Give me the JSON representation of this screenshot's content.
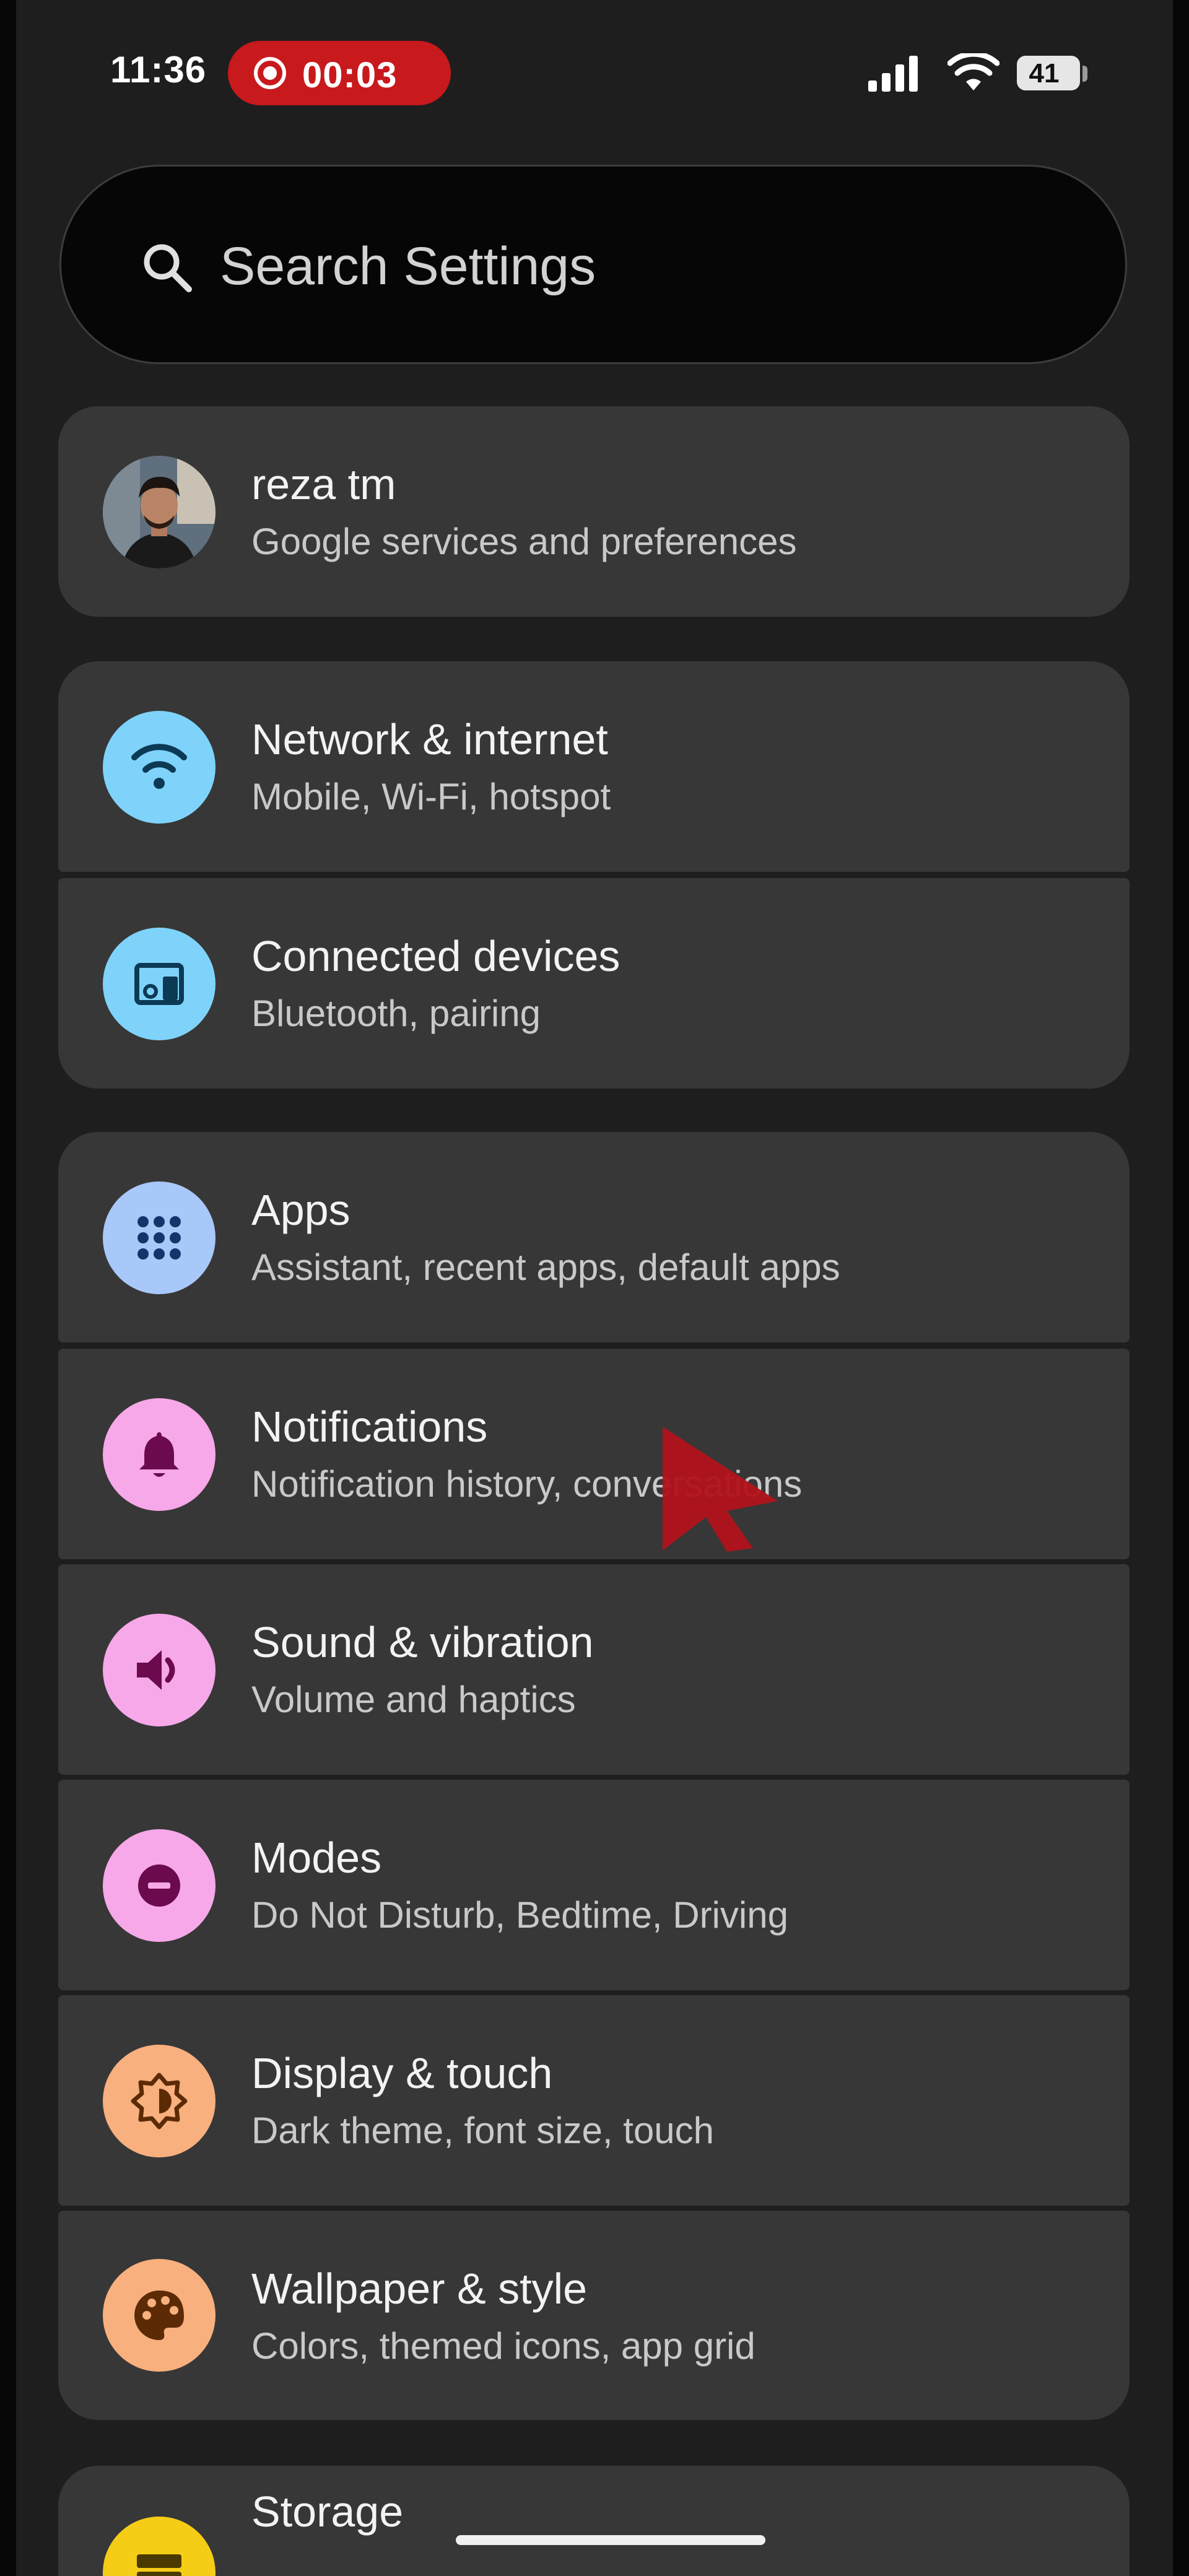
{
  "status_bar": {
    "time": "11:36",
    "recording_time": "00:03",
    "battery": "41",
    "recording_color": "#c8191d"
  },
  "search": {
    "placeholder": "Search Settings"
  },
  "account": {
    "name": "reza tm",
    "subtitle": "Google services and preferences"
  },
  "settings": [
    {
      "title": "Network & internet",
      "subtitle": "Mobile, Wi-Fi, hotspot",
      "icon": "wifi-icon",
      "color": "#7fd3fb"
    },
    {
      "title": "Connected devices",
      "subtitle": "Bluetooth, pairing",
      "icon": "devices-icon",
      "color": "#7fd3fb"
    },
    {
      "title": "Apps",
      "subtitle": "Assistant, recent apps, default apps",
      "icon": "apps-grid-icon",
      "color": "#a9c8fa"
    },
    {
      "title": "Notifications",
      "subtitle": "Notification history, conversations",
      "icon": "bell-icon",
      "color": "#f6a8e8"
    },
    {
      "title": "Sound & vibration",
      "subtitle": "Volume and haptics",
      "icon": "speaker-icon",
      "color": "#f6a8e8"
    },
    {
      "title": "Modes",
      "subtitle": "Do Not Disturb, Bedtime, Driving",
      "icon": "do-not-disturb-icon",
      "color": "#f6a8e8"
    },
    {
      "title": "Display & touch",
      "subtitle": "Dark theme, font size, touch",
      "icon": "brightness-icon",
      "color": "#f8b07e"
    },
    {
      "title": "Wallpaper & style",
      "subtitle": "Colors, themed icons, app grid",
      "icon": "palette-icon",
      "color": "#f8b07e"
    },
    {
      "title": "Storage",
      "subtitle": "",
      "icon": "storage-icon",
      "color": "#f5cd17"
    }
  ],
  "colors": {
    "background": "#1e1e1e",
    "card": "#373737",
    "cursor": "#b1121a"
  }
}
